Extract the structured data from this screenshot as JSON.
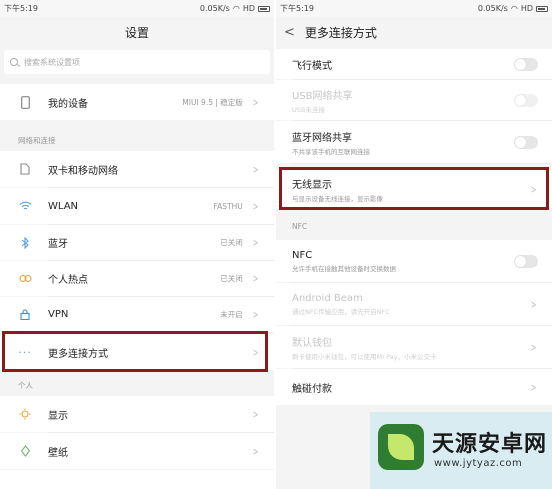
{
  "left": {
    "status": {
      "time": "下午5:19",
      "speed": "0.05K/s",
      "hd": "HD"
    },
    "title": "设置",
    "search": {
      "placeholder": "搜索系统设置项"
    },
    "my_device": {
      "label": "我的设备",
      "value": "MIUI 9.5 | 稳定版"
    },
    "section_network": "网络和连接",
    "items": [
      {
        "label": "双卡和移动网络",
        "value": "",
        "icon": "sim-icon"
      },
      {
        "label": "WLAN",
        "value": "FASTHU",
        "icon": "wifi-icon"
      },
      {
        "label": "蓝牙",
        "value": "已关闭",
        "icon": "bluetooth-icon"
      },
      {
        "label": "个人热点",
        "value": "已关闭",
        "icon": "hotspot-icon"
      },
      {
        "label": "VPN",
        "value": "未开启",
        "icon": "vpn-icon"
      },
      {
        "label": "更多连接方式",
        "value": "",
        "icon": "more-icon"
      }
    ],
    "section_personal": "个人",
    "personal": [
      {
        "label": "显示",
        "icon": "brightness-icon"
      },
      {
        "label": "壁纸",
        "icon": "wallpaper-icon"
      }
    ]
  },
  "right": {
    "status": {
      "time": "下午5:19",
      "speed": "0.05K/s",
      "hd": "HD"
    },
    "title": "更多连接方式",
    "items": [
      {
        "title": "飞行模式",
        "subtitle": "",
        "control": "toggle",
        "disabled": false
      },
      {
        "title": "USB网络共享",
        "subtitle": "USB未连接",
        "control": "toggle",
        "disabled": true
      },
      {
        "title": "蓝牙网络共享",
        "subtitle": "不共享该手机的互联网连接",
        "control": "toggle",
        "disabled": false
      },
      {
        "title": "无线显示",
        "subtitle": "与显示设备无线连接，显示影像",
        "control": "chevron",
        "disabled": false
      }
    ],
    "section_nfc": "NFC",
    "nfc_items": [
      {
        "title": "NFC",
        "subtitle": "允许手机在接触其他设备时交换数据",
        "control": "toggle",
        "disabled": false
      },
      {
        "title": "Android Beam",
        "subtitle": "通过NFC传输应用，请先开启NFC",
        "control": "chevron",
        "disabled": true
      },
      {
        "title": "默认钱包",
        "subtitle": "刷卡使用小米钱包，可以使用MI Pay，小米公交卡",
        "control": "chevron",
        "disabled": true
      },
      {
        "title": "触碰付款",
        "subtitle": "",
        "control": "chevron",
        "disabled": false
      }
    ]
  },
  "watermark": {
    "name": "天源安卓网",
    "url": "www.jytyaz.com"
  },
  "colors": {
    "highlight": "#8b1a1a",
    "background": "#f4f4f4"
  }
}
